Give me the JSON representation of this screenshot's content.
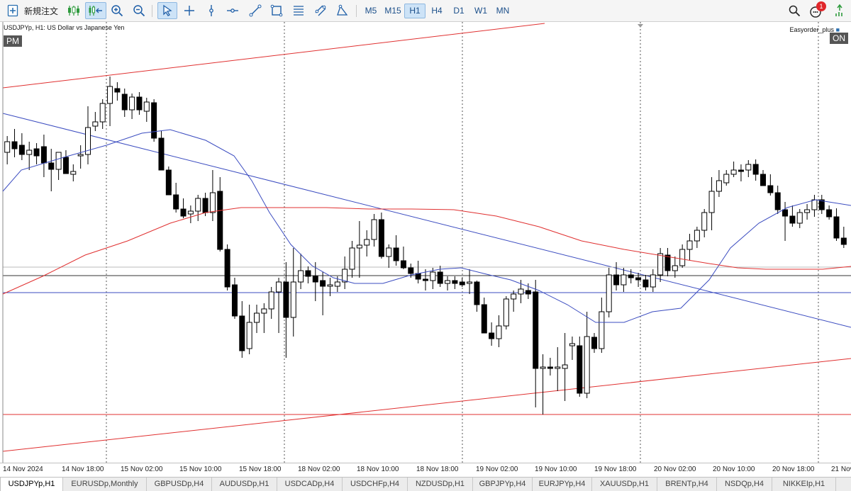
{
  "toolbar": {
    "new_order_label": "新規注文",
    "timeframes": [
      "M5",
      "M15",
      "H1",
      "H4",
      "D1",
      "W1",
      "MN"
    ],
    "active_timeframe": "H1",
    "notification_count": "1",
    "icons": [
      "new-order-icon",
      "algo-trading-icon",
      "one-click-trading-icon",
      "zoom-in-icon",
      "zoom-out-icon",
      "cursor-icon",
      "crosshair-icon",
      "vertical-line-icon",
      "horizontal-line-icon",
      "trendline-icon",
      "rectangle-icon",
      "fibonacci-icon",
      "channel-icon",
      "triangle-icon",
      "search-icon",
      "notification-icon",
      "signal-icon"
    ]
  },
  "chart": {
    "symbol_label": "USDJPYp, H1:  US Dollar vs Japanese Yen",
    "session_label": "PM",
    "ea_label": "Easyorder_plus",
    "ea_status": "ON",
    "colors": {
      "candle_up": "#ffffff",
      "candle_down": "#000000",
      "ma_fast": "#3b4cc0",
      "ma_slow": "#e03030",
      "channel": "#e03030",
      "trendline": "#3b4cc0"
    }
  },
  "time_axis": [
    "14 Nov 2024",
    "14 Nov 18:00",
    "15 Nov 02:00",
    "15 Nov 10:00",
    "15 Nov 18:00",
    "18 Nov 02:00",
    "18 Nov 10:00",
    "18 Nov 18:00",
    "19 Nov 02:00",
    "19 Nov 10:00",
    "19 Nov 18:00",
    "20 Nov 02:00",
    "20 Nov 10:00",
    "20 Nov 18:00",
    "21 Nov"
  ],
  "tabs": [
    {
      "label": "USDJPYp,H1",
      "active": true
    },
    {
      "label": "EURUSDp,Monthly",
      "active": false
    },
    {
      "label": "GBPUSDp,H4",
      "active": false
    },
    {
      "label": "AUDUSDp,H1",
      "active": false
    },
    {
      "label": "USDCADp,H4",
      "active": false
    },
    {
      "label": "USDCHFp,H4",
      "active": false
    },
    {
      "label": "NZDUSDp,H1",
      "active": false
    },
    {
      "label": "GBPJPYp,H4",
      "active": false
    },
    {
      "label": "EURJPYp,H4",
      "active": false
    },
    {
      "label": "XAUUSDp,H1",
      "active": false
    },
    {
      "label": "BRENTp,H4",
      "active": false
    },
    {
      "label": "NSDQp,H4",
      "active": false
    },
    {
      "label": "NIKKEIp,H1",
      "active": false
    }
  ]
}
